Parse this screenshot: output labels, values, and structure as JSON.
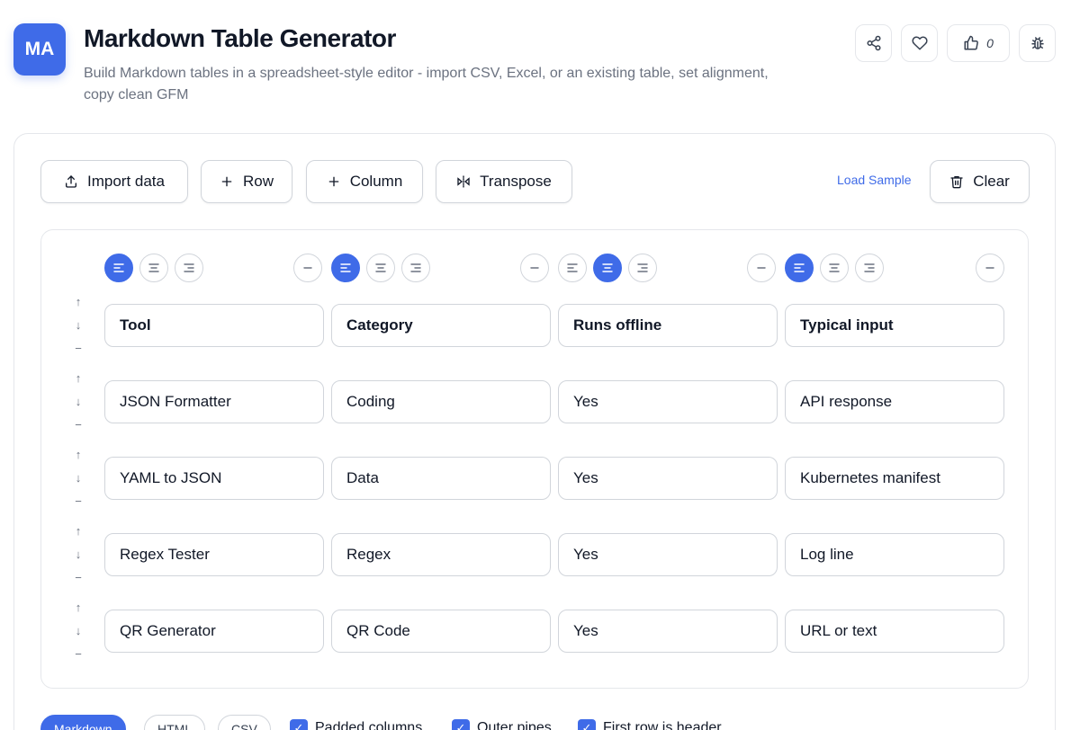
{
  "app": {
    "logo_text": "MA",
    "title": "Markdown Table Generator",
    "subtitle": "Build Markdown tables in a spreadsheet-style editor - import CSV, Excel, or an existing table, set alignment, copy clean GFM",
    "like_count": "0"
  },
  "header_icons": [
    "share-icon",
    "heart-icon",
    "thumbs-up-icon",
    "bug-icon"
  ],
  "toolbar": {
    "import_label": "Import data",
    "row_label": "Row",
    "column_label": "Column",
    "transpose_label": "Transpose",
    "load_sample_label": "Load Sample",
    "clear_label": "Clear"
  },
  "row_controls": {
    "up": "↑",
    "down": "↓",
    "remove": "−"
  },
  "table": {
    "column_alignments": [
      "left",
      "left",
      "center",
      "left"
    ],
    "rows": [
      [
        "Tool",
        "Category",
        "Runs offline",
        "Typical input"
      ],
      [
        "JSON Formatter",
        "Coding",
        "Yes",
        "API response"
      ],
      [
        "YAML to JSON",
        "Data",
        "Yes",
        "Kubernetes manifest"
      ],
      [
        "Regex Tester",
        "Regex",
        "Yes",
        "Log line"
      ],
      [
        "QR Generator",
        "QR Code",
        "Yes",
        "URL or text"
      ]
    ]
  },
  "output": {
    "tabs": [
      "Markdown",
      "HTML",
      "CSV"
    ],
    "active_tab": "Markdown",
    "options": [
      "Padded columns",
      "Outer pipes",
      "First row is header"
    ]
  },
  "colors": {
    "accent": "#3f6be8",
    "border": "#d1d5db"
  }
}
